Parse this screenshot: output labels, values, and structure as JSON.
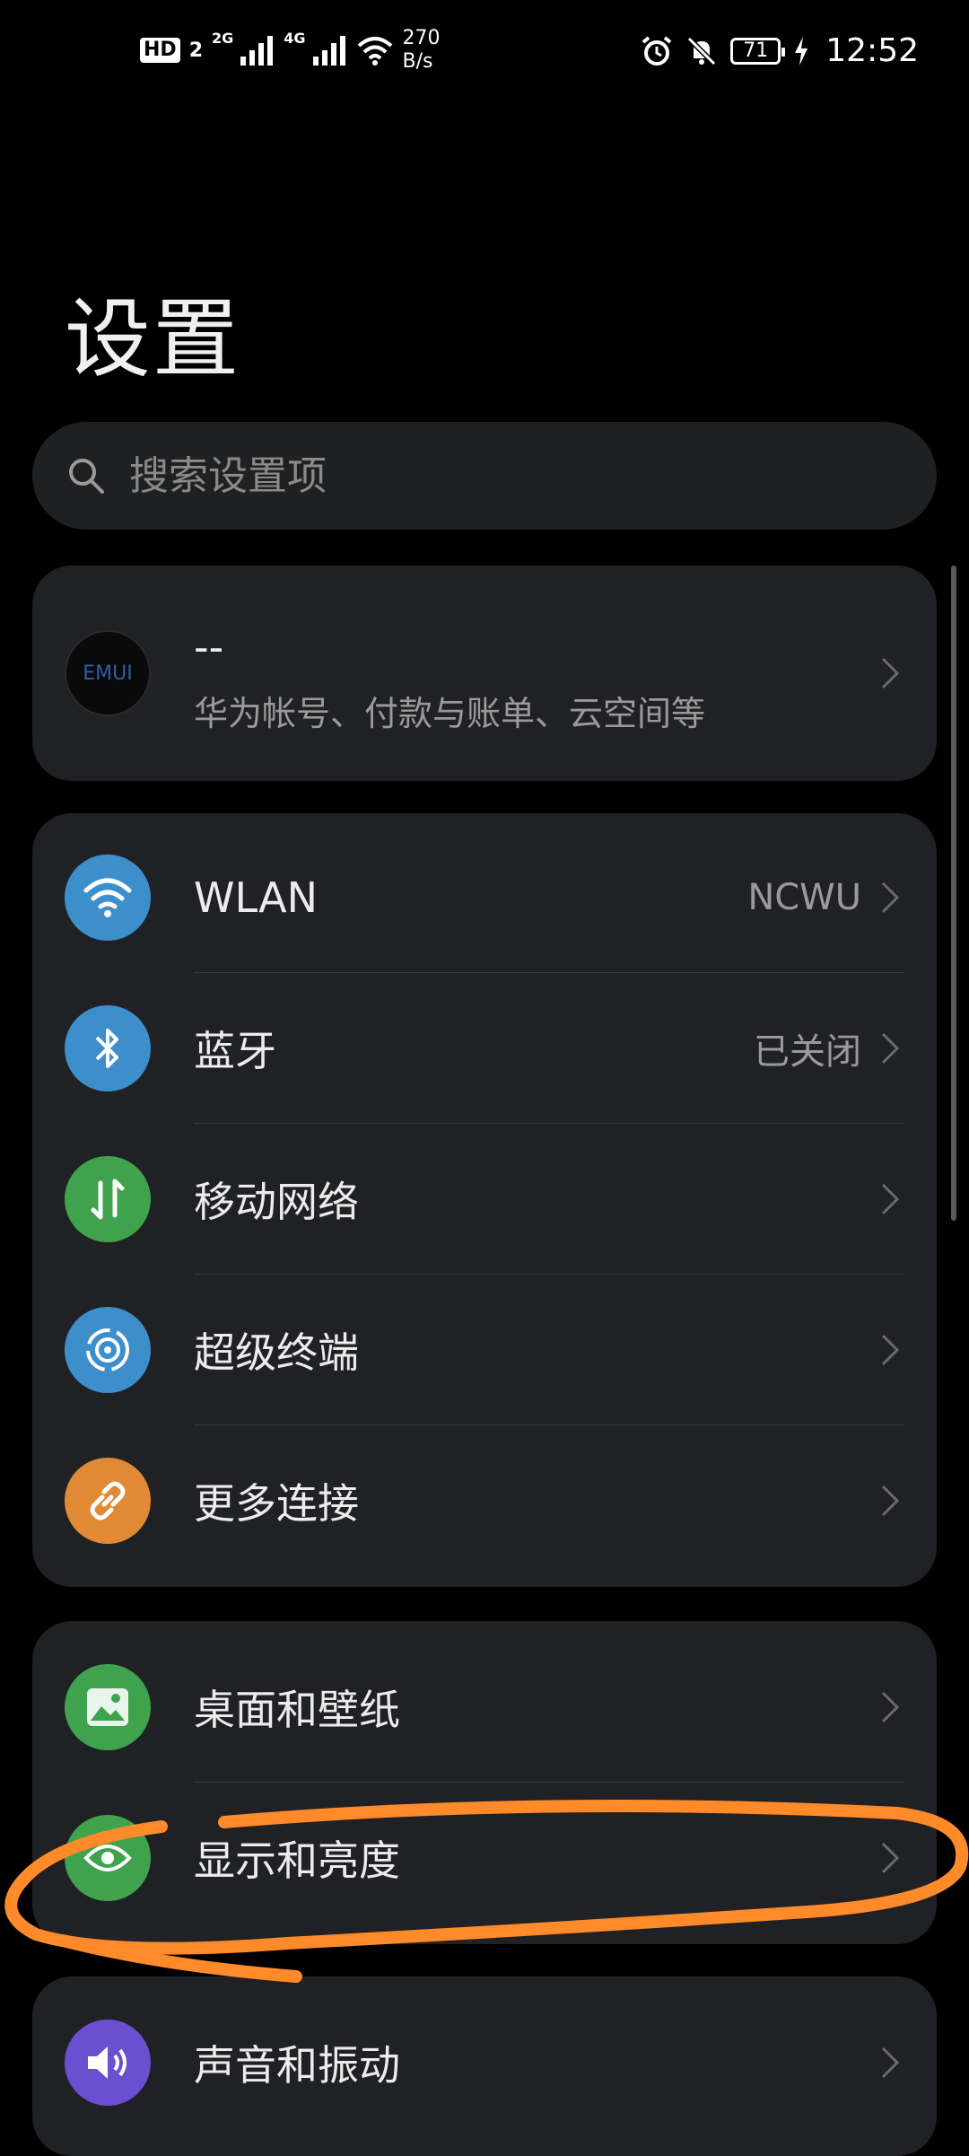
{
  "status_bar": {
    "hd": "HD",
    "sim": "2",
    "net1": "2G",
    "net2": "4G",
    "speed_top": "270",
    "speed_bottom": "B/s",
    "battery": "71",
    "time": "12:52"
  },
  "title": "设置",
  "search": {
    "placeholder": "搜索设置项"
  },
  "account": {
    "avatar_text": "EMUI",
    "name": "--",
    "subtitle": "华为帐号、付款与账单、云空间等"
  },
  "connectivity": [
    {
      "label": "WLAN",
      "value": "NCWU",
      "color": "#3d8fcc",
      "icon": "wifi-icon"
    },
    {
      "label": "蓝牙",
      "value": "已关闭",
      "color": "#3d8fcc",
      "icon": "bluetooth-icon"
    },
    {
      "label": "移动网络",
      "value": "",
      "color": "#3fa34d",
      "icon": "mobile-data-icon"
    },
    {
      "label": "超级终端",
      "value": "",
      "color": "#3d8fcc",
      "icon": "super-device-icon"
    },
    {
      "label": "更多连接",
      "value": "",
      "color": "#e08a35",
      "icon": "link-icon"
    }
  ],
  "display_group": [
    {
      "label": "桌面和壁纸",
      "color": "#3fa34d",
      "icon": "image-icon"
    },
    {
      "label": "显示和亮度",
      "color": "#3fa34d",
      "icon": "eye-icon"
    }
  ],
  "sound_group": [
    {
      "label": "声音和振动",
      "color": "#6b4fd0",
      "icon": "speaker-icon"
    }
  ],
  "annotation_color": "#ff8a2a"
}
